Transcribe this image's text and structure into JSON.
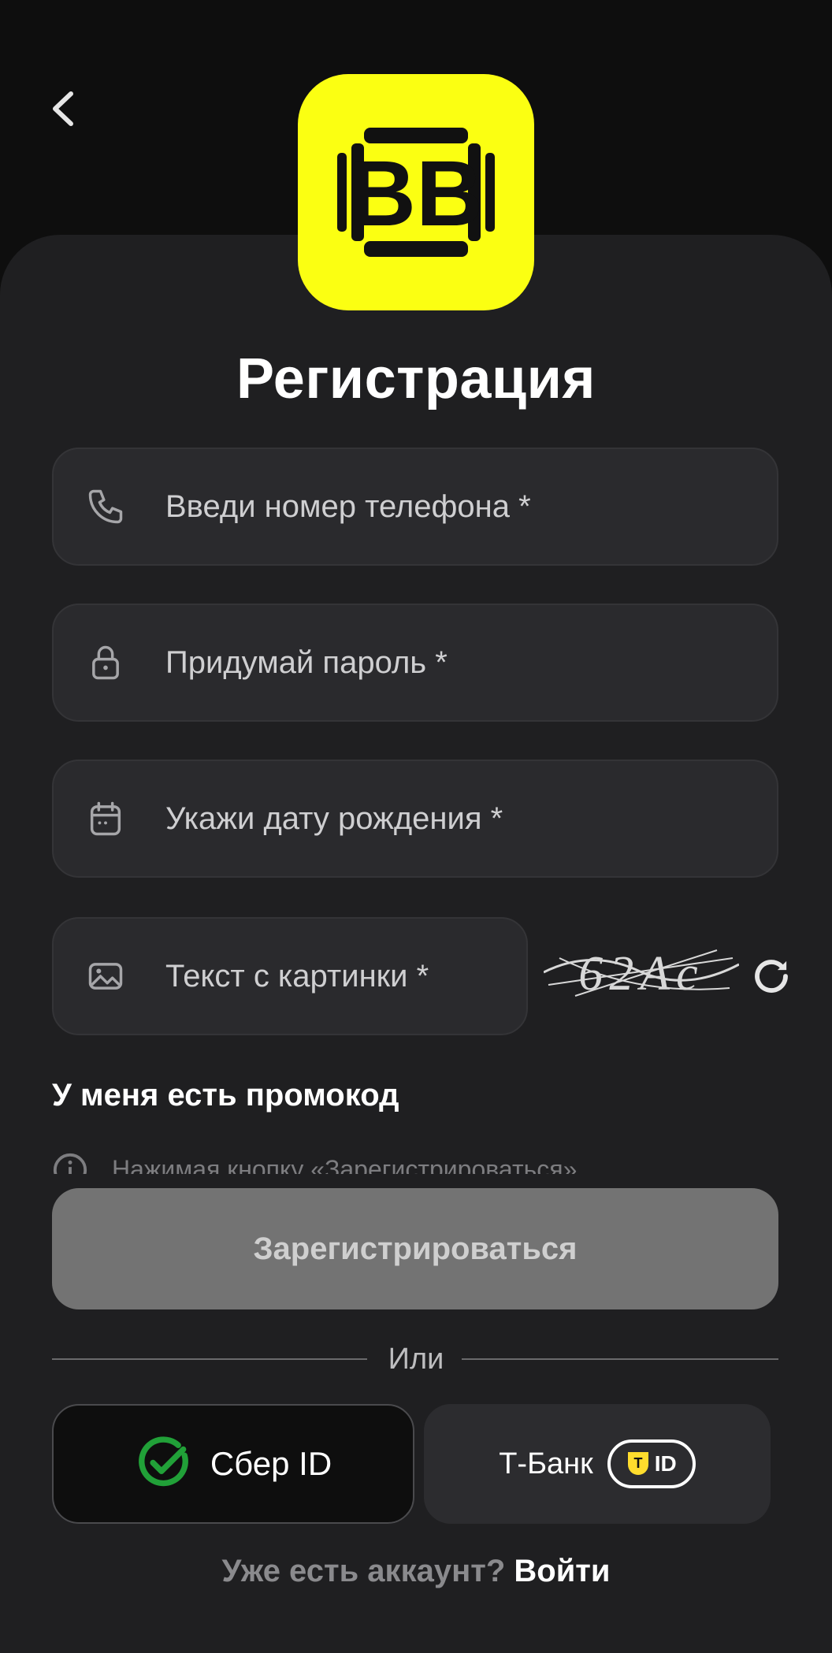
{
  "header": {
    "back_icon": "chevron-left-icon"
  },
  "logo": {
    "letters": "BB",
    "color": "#fbff12"
  },
  "title": "Регистрация",
  "form": {
    "phone": {
      "placeholder": "Введи номер телефона *",
      "icon": "phone-icon"
    },
    "password": {
      "placeholder": "Придумай пароль *",
      "icon": "lock-icon"
    },
    "birthdate": {
      "placeholder": "Укажи дату рождения *",
      "icon": "calendar-icon"
    },
    "captcha": {
      "placeholder": "Текст с картинки *",
      "icon": "image-icon",
      "image_text": "62Ac",
      "refresh_icon": "refresh-icon"
    }
  },
  "promo_label": "У меня есть промокод",
  "notice_text": "Нажимая кнопку «Зарегистрироваться»",
  "register_label": "Зарегистрироваться",
  "or_label": "Или",
  "sber": {
    "label": "Сбер ID",
    "color": "#21a038"
  },
  "tbank": {
    "label": "Т-Банк",
    "badge_letter": "Т",
    "badge_text": "ID",
    "badge_color": "#ffdd2d"
  },
  "login": {
    "question": "Уже есть аккаунт?",
    "link": "Войти"
  }
}
